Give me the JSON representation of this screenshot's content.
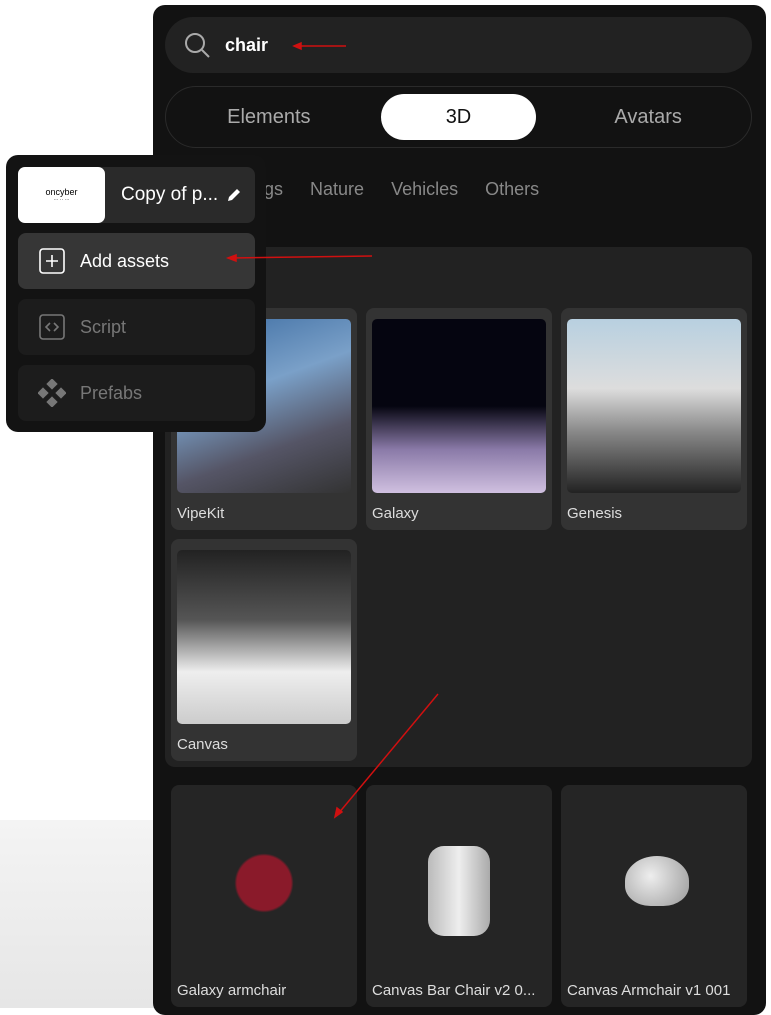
{
  "search": {
    "value": "chair"
  },
  "tabs": [
    {
      "label": "Elements"
    },
    {
      "label": "3D",
      "active": true
    },
    {
      "label": "Avatars"
    }
  ],
  "categories": [
    "dings",
    "Nature",
    "Vehicles",
    "Others"
  ],
  "group_cards": [
    {
      "label": "VipeKit"
    },
    {
      "label": "Galaxy"
    },
    {
      "label": "Genesis"
    },
    {
      "label": "Canvas"
    }
  ],
  "asset_cards": [
    {
      "label": "Galaxy armchair"
    },
    {
      "label": "Canvas Bar Chair v2 0..."
    },
    {
      "label": "Canvas Armchair v1 001"
    }
  ],
  "popup": {
    "thumbnail_text": "oncyber",
    "project_name": "Copy of p...",
    "items": [
      {
        "label": "Add assets",
        "icon": "plus-square-icon"
      },
      {
        "label": "Script",
        "icon": "code-icon"
      },
      {
        "label": "Prefabs",
        "icon": "prefabs-diamond-icon"
      }
    ]
  },
  "colors": {
    "annotation_arrow": "#d01010",
    "panel": "#121212",
    "card": "#333333"
  }
}
